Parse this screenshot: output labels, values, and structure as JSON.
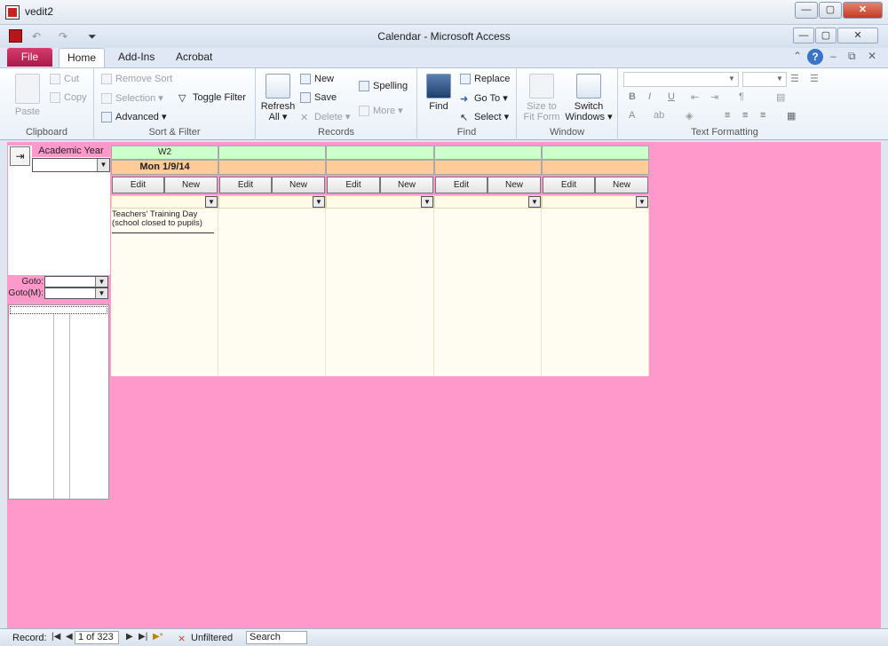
{
  "outer": {
    "title": "vedit2",
    "min": "—",
    "max": "▢",
    "close": "✕"
  },
  "access": {
    "title": "Calendar  -  Microsoft Access",
    "undo": "↶",
    "redo": "↷",
    "qat_menu": "⏷"
  },
  "tabs": {
    "file": "File",
    "home": "Home",
    "addins": "Add-Ins",
    "acrobat": "Acrobat",
    "help": "?"
  },
  "ribbon": {
    "clipboard": {
      "label": "Clipboard",
      "paste": "Paste",
      "cut": "Cut",
      "copy": "Copy"
    },
    "sort": {
      "label": "Sort & Filter",
      "remove_sort": "Remove Sort",
      "selection": "Selection ▾",
      "advanced": "Advanced ▾",
      "toggle": "Toggle Filter"
    },
    "records": {
      "label": "Records",
      "refresh": "Refresh",
      "refresh2": "All ▾",
      "new": "New",
      "save": "Save",
      "delete": "Delete ▾",
      "spelling": "Spelling",
      "more": "More ▾"
    },
    "find": {
      "label": "Find",
      "find": "Find",
      "replace": "Replace",
      "goto": "Go To ▾",
      "select": "Select ▾"
    },
    "window": {
      "label": "Window",
      "size": "Size to",
      "size2": "Fit Form",
      "switch": "Switch",
      "switch2": "Windows ▾"
    },
    "text": {
      "label": "Text Formatting",
      "bold": "B",
      "italic": "I",
      "underline": "U",
      "fontcolor": "A"
    }
  },
  "left": {
    "exit_icon": "⇥",
    "academic_year_label": "Academic Year",
    "goto1_label": "Goto:",
    "goto2_label": "Goto(M):"
  },
  "calendar": {
    "columns": [
      {
        "week": "W2",
        "date": "Mon 1/9/14",
        "edit": "Edit",
        "new": "New",
        "event_line1": "Teachers' Training Day",
        "event_line2": "(school closed to pupils)"
      },
      {
        "week": "",
        "date": "",
        "edit": "Edit",
        "new": "New"
      },
      {
        "week": "",
        "date": "",
        "edit": "Edit",
        "new": "New"
      },
      {
        "week": "",
        "date": "",
        "edit": "Edit",
        "new": "New"
      },
      {
        "week": "",
        "date": "",
        "edit": "Edit",
        "new": "New"
      }
    ]
  },
  "status": {
    "record_label": "Record:",
    "record_value": "1 of 323",
    "first": "|◀",
    "prev": "◀",
    "next": "▶",
    "last": "▶|",
    "new": "▶*",
    "filter_icon": "⨯",
    "filter_label": "Unfiltered",
    "search": "Search"
  },
  "colors": {
    "workspace": "#ff99cc",
    "week_header": "#ccffcc",
    "date_header": "#ffcc99",
    "file_tab": "#c02557"
  }
}
